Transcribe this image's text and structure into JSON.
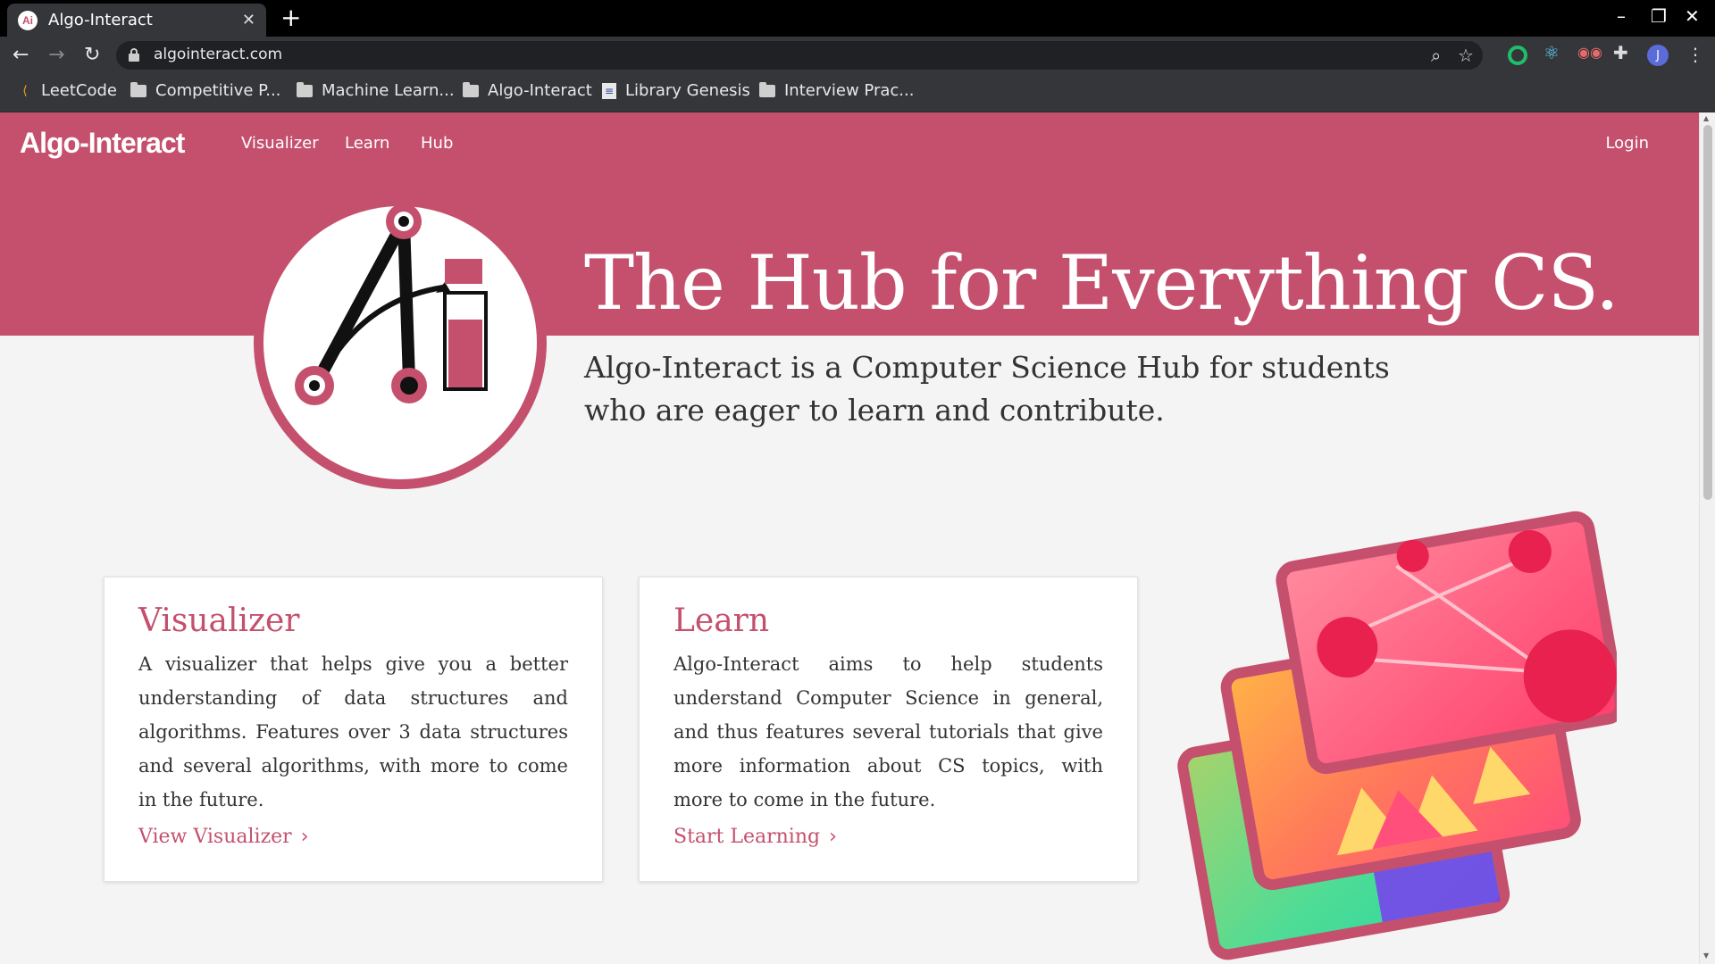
{
  "browser": {
    "tab_title": "Algo-Interact",
    "favicon_text": "Ai",
    "url": "algointeract.com",
    "profile_initial": "J",
    "bookmarks": [
      {
        "label": "LeetCode",
        "icon": "leetcode-icon"
      },
      {
        "label": "Competitive P...",
        "icon": "folder-icon"
      },
      {
        "label": "Machine Learn...",
        "icon": "folder-icon"
      },
      {
        "label": "Algo-Interact",
        "icon": "folder-icon"
      },
      {
        "label": "Library Genesis",
        "icon": "libgen-icon"
      },
      {
        "label": "Interview Prac...",
        "icon": "folder-icon"
      }
    ]
  },
  "site": {
    "logo": "Algo-Interact",
    "nav": [
      "Visualizer",
      "Learn",
      "Hub"
    ],
    "login": "Login",
    "brand_color": "#c4506d"
  },
  "hero": {
    "title": "The Hub for Everything CS.",
    "subtitle": "Algo-Interact is a Computer Science Hub for students who are eager to learn and contribute."
  },
  "cards": [
    {
      "title": "Visualizer",
      "body": "A visualizer that helps give you a better understanding of data structures and algorithms. Features over 3 data structures and several algorithms, with more to come in the future.",
      "cta": "View Visualizer"
    },
    {
      "title": "Learn",
      "body": "Algo-Interact aims to help students understand Computer Science in general, and thus features several tutorials that give more information about CS topics, with more to come in the future.",
      "cta": "Start Learning"
    }
  ]
}
